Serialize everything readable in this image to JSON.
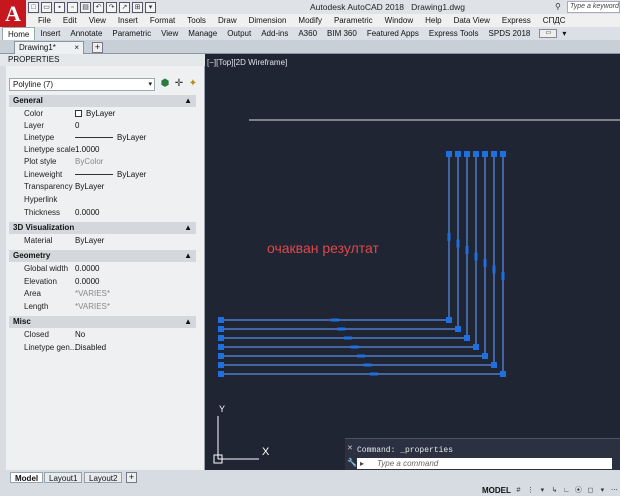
{
  "app": {
    "title": "Autodesk AutoCAD 2018",
    "file": "Drawing1.dwg",
    "logo_letter": "A",
    "search_placeholder": "Type a keyword or phrase"
  },
  "menu": [
    "File",
    "Edit",
    "View",
    "Insert",
    "Format",
    "Tools",
    "Draw",
    "Dimension",
    "Modify",
    "Parametric",
    "Window",
    "Help",
    "Data View",
    "Express",
    "СПДС"
  ],
  "ribbon_tabs": [
    "Home",
    "Insert",
    "Annotate",
    "Parametric",
    "View",
    "Manage",
    "Output",
    "Add-ins",
    "A360",
    "BIM 360",
    "Featured Apps",
    "Express Tools",
    "SPDS 2018"
  ],
  "doc_tab": {
    "label": "Drawing1*",
    "close": "×",
    "new": "+"
  },
  "palette": {
    "title": "PROPERTIES",
    "selection": "Polyline (7)",
    "sections": {
      "general": "General",
      "visualization": "3D Visualization",
      "geometry": "Geometry",
      "misc": "Misc"
    },
    "general": [
      {
        "name": "Color",
        "value": "ByLayer"
      },
      {
        "name": "Layer",
        "value": "0"
      },
      {
        "name": "Linetype",
        "value": "ByLayer"
      },
      {
        "name": "Linetype scale",
        "value": "1.0000"
      },
      {
        "name": "Plot style",
        "value": "ByColor"
      },
      {
        "name": "Lineweight",
        "value": "ByLayer"
      },
      {
        "name": "Transparency",
        "value": "ByLayer"
      },
      {
        "name": "Hyperlink",
        "value": ""
      },
      {
        "name": "Thickness",
        "value": "0.0000"
      }
    ],
    "visualization": [
      {
        "name": "Material",
        "value": "ByLayer"
      }
    ],
    "geometry": [
      {
        "name": "Global width",
        "value": "0.0000"
      },
      {
        "name": "Elevation",
        "value": "0.0000"
      },
      {
        "name": "Area",
        "value": "*VARIES*"
      },
      {
        "name": "Length",
        "value": "*VARIES*"
      }
    ],
    "misc": [
      {
        "name": "Closed",
        "value": "No"
      },
      {
        "name": "Linetype gen...",
        "value": "Disabled"
      }
    ]
  },
  "viewport": {
    "label": "[−][Top][2D Wireframe]",
    "annotation": "очакван резултат",
    "ucs_x": "X",
    "ucs_y": "Y"
  },
  "command": {
    "history": "Command: _properties",
    "placeholder": "Type a command"
  },
  "layout_tabs": [
    "Model",
    "Layout1",
    "Layout2"
  ],
  "status": {
    "model": "MODEL"
  },
  "colors": {
    "accent_red": "#c6171e",
    "grip_blue": "#1e6fe0",
    "selected_line": "#5a8fe8",
    "annotation": "#e0474c"
  }
}
